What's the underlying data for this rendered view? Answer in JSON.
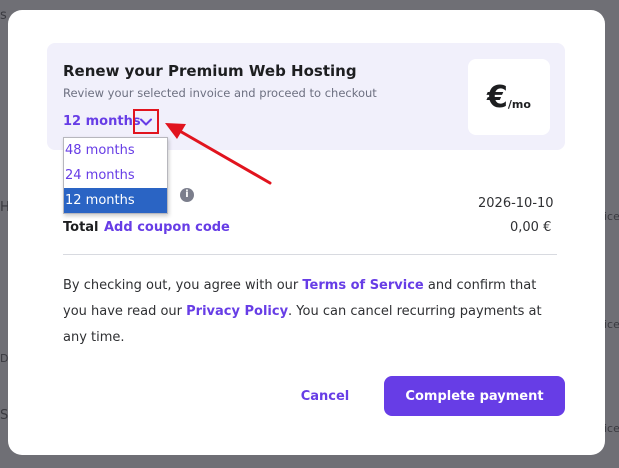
{
  "background": {
    "fragments": [
      "s",
      "H",
      "Di",
      "S",
      "ice",
      "ice",
      "ice"
    ]
  },
  "modal": {
    "title": "Renew your Premium Web Hosting",
    "subtitle": "Review your selected invoice and proceed to checkout",
    "period": {
      "selected_label": "12 months",
      "options": [
        "48 months",
        "24 months",
        "12 months"
      ],
      "selected_index": 2
    },
    "currency": {
      "symbol": "€",
      "unit": "/mo"
    },
    "summary": {
      "expiry_date": "2026-10-10",
      "total_label": "Total",
      "coupon_link": "Add coupon code",
      "total_value": "0,00 €"
    },
    "terms": {
      "part1": "By checking out, you agree with our ",
      "tos_link": "Terms of Service",
      "part2": " and confirm that you have read our ",
      "privacy_link": "Privacy Policy",
      "part3": ". You can cancel recurring payments at any time."
    },
    "actions": {
      "cancel_label": "Cancel",
      "pay_label": "Complete payment"
    }
  },
  "colors": {
    "accent": "#673de6",
    "highlight": "#e1141e",
    "selected_option": "#2a64c4"
  }
}
